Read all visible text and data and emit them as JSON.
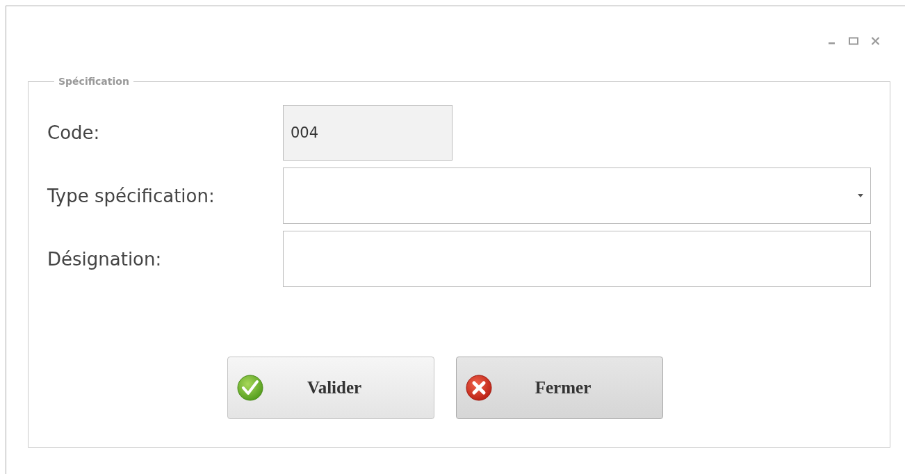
{
  "group": {
    "title": "Spécification"
  },
  "fields": [
    {
      "kind": "readonly",
      "label": "Code:",
      "value": "004"
    },
    {
      "kind": "combo",
      "label": "Type spécification:"
    },
    {
      "kind": "text",
      "label": "Désignation:"
    }
  ],
  "buttons": [
    {
      "kind": "confirm",
      "label": "Valider",
      "hovered": false
    },
    {
      "kind": "cancel",
      "label": "Fermer",
      "hovered": true
    }
  ]
}
